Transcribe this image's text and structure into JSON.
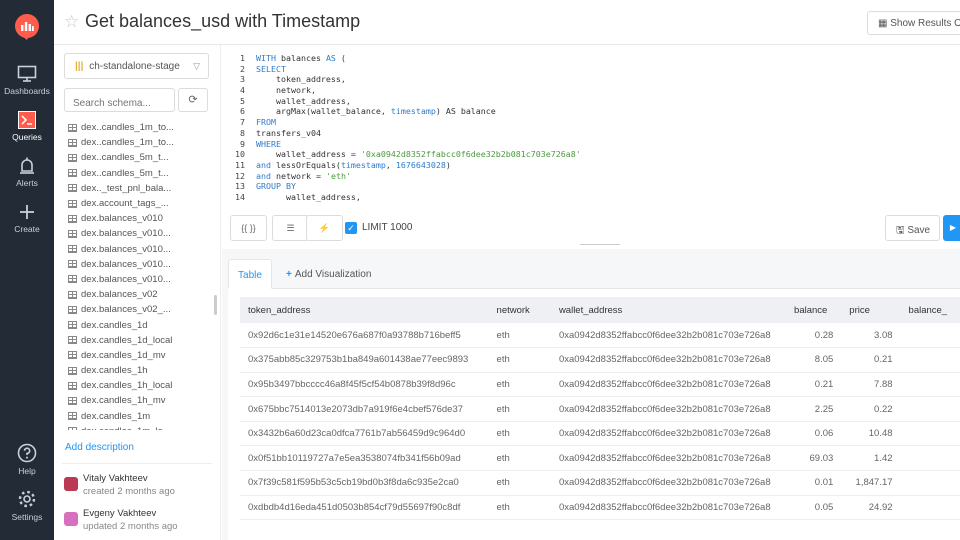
{
  "header": {
    "title": "Get balances_usd with Timestamp",
    "show_results_label": "Show Results Or"
  },
  "nav": {
    "items": [
      {
        "label": "Dashboards",
        "icon": "monitor-icon"
      },
      {
        "label": "Queries",
        "icon": "terminal-icon"
      },
      {
        "label": "Alerts",
        "icon": "bell-icon"
      },
      {
        "label": "Create",
        "icon": "plus-icon"
      },
      {
        "label": "Help",
        "icon": "help-icon"
      },
      {
        "label": "Settings",
        "icon": "gear-icon"
      }
    ]
  },
  "schema": {
    "datasource": "ch-standalone-stage",
    "search_placeholder": "Search schema...",
    "tables": [
      "dex..candles_1m_to...",
      "dex..candles_1m_to...",
      "dex..candles_5m_t...",
      "dex..candles_5m_t...",
      "dex.._test_pnl_bala...",
      "dex.account_tags_...",
      "dex.balances_v010",
      "dex.balances_v010...",
      "dex.balances_v010...",
      "dex.balances_v010...",
      "dex.balances_v010...",
      "dex.balances_v02",
      "dex.balances_v02_...",
      "dex.candles_1d",
      "dex.candles_1d_local",
      "dex.candles_1d_mv",
      "dex.candles_1h",
      "dex.candles_1h_local",
      "dex.candles_1h_mv",
      "dex.candles_1m",
      "dex.candles_1m_lo..."
    ],
    "add_description": "Add description",
    "created_by": "Vitaly Vakhteev",
    "created_when": "created 2 months ago",
    "updated_by": "Evgeny Vakhteev",
    "updated_when": "updated 2 months ago"
  },
  "editor": {
    "line_numbers": [
      "1",
      "2",
      "3",
      "4",
      "5",
      "6",
      "7",
      "8",
      "9",
      "10",
      "11",
      "12",
      "13",
      "14"
    ],
    "wallet_literal": "'0xa0942d8352ffabcc0f6dee32b2b081c703e726a8'",
    "timestamp_literal": "1676643028",
    "network_literal": "'eth'",
    "table_name": "transfers_v04"
  },
  "toolbar": {
    "params_label": "{{ }}",
    "limit_label": "LIMIT 1000",
    "limit_checked": true,
    "save_label": "Save"
  },
  "results": {
    "tabs": {
      "table": "Table",
      "add_visualization": "Add Visualization"
    },
    "columns": [
      "token_address",
      "network",
      "wallet_address",
      "balance",
      "price",
      "balance_"
    ],
    "rows": [
      [
        "0x92d6c1e31e14520e676a687f0a93788b716beff5",
        "eth",
        "0xa0942d8352ffabcc0f6dee32b2b081c703e726a8",
        "0.28",
        "3.08"
      ],
      [
        "0x375abb85c329753b1ba849a601438ae77eec9893",
        "eth",
        "0xa0942d8352ffabcc0f6dee32b2b081c703e726a8",
        "8.05",
        "0.21"
      ],
      [
        "0x95b3497bbcccc46a8f45f5cf54b0878b39f8d96c",
        "eth",
        "0xa0942d8352ffabcc0f6dee32b2b081c703e726a8",
        "0.21",
        "7.88"
      ],
      [
        "0x675bbc7514013e2073db7a919f6e4cbef576de37",
        "eth",
        "0xa0942d8352ffabcc0f6dee32b2b081c703e726a8",
        "2.25",
        "0.22"
      ],
      [
        "0x3432b6a60d23ca0dfca7761b7ab56459d9c964d0",
        "eth",
        "0xa0942d8352ffabcc0f6dee32b2b081c703e726a8",
        "0.06",
        "10.48"
      ],
      [
        "0x0f51bb10119727a7e5ea3538074fb341f56b09ad",
        "eth",
        "0xa0942d8352ffabcc0f6dee32b2b081c703e726a8",
        "69.03",
        "1.42"
      ],
      [
        "0x7f39c581f595b53c5cb19bd0b3f8da6c935e2ca0",
        "eth",
        "0xa0942d8352ffabcc0f6dee32b2b081c703e726a8",
        "0.01",
        "1,847.17"
      ],
      [
        "0xdbdb4d16eda451d0503b854cf79d55697f90c8df",
        "eth",
        "0xa0942d8352ffabcc0f6dee32b2b081c703e726a8",
        "0.05",
        "24.92"
      ]
    ]
  },
  "colors": {
    "nav_bg": "#222b36",
    "accent": "#2196f3",
    "logo": "#ff5c4d"
  }
}
